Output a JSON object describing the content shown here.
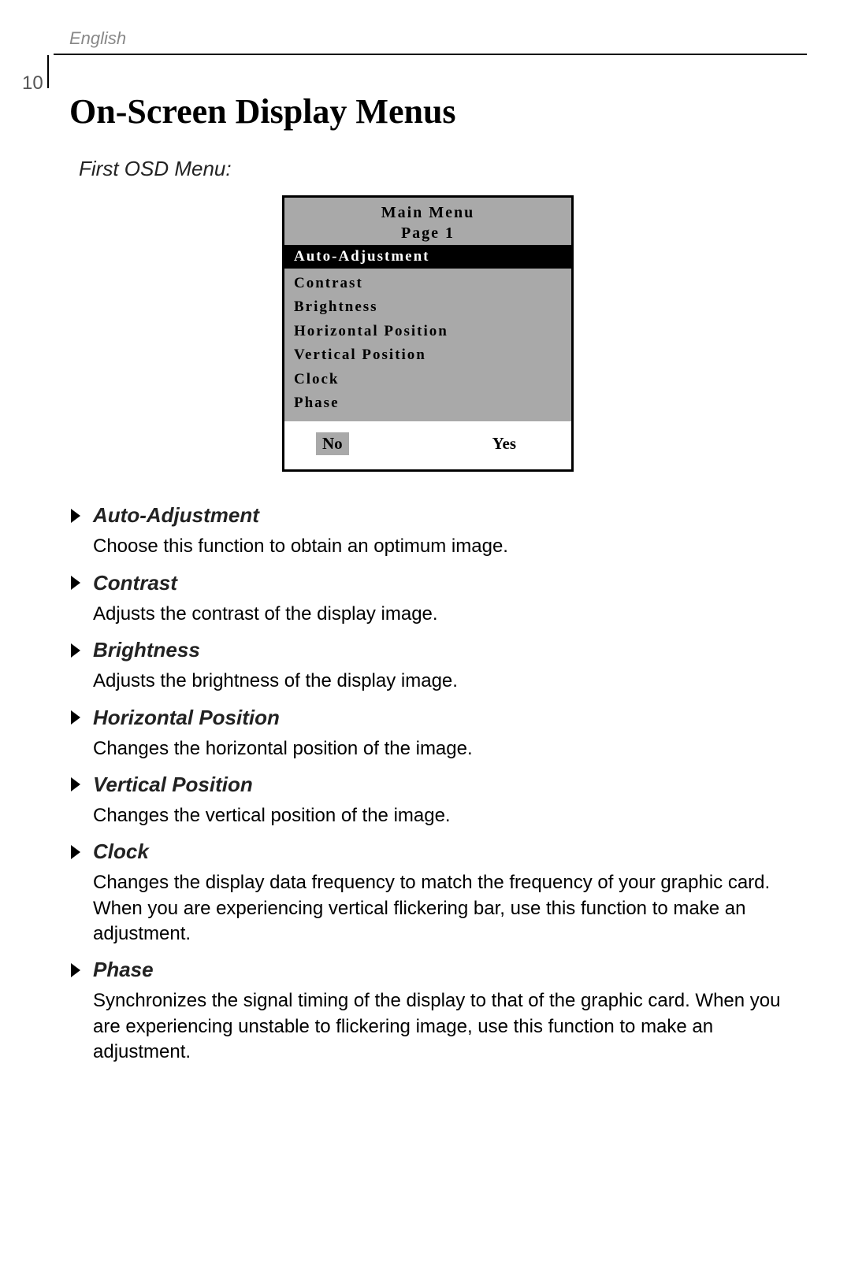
{
  "header": {
    "language": "English",
    "page_number": "10"
  },
  "title": "On-Screen Display Menus",
  "subtitle": "First OSD Menu:",
  "osd": {
    "header_line1": "Main Menu",
    "header_line2": "Page 1",
    "selected": "Auto-Adjustment",
    "items": [
      "Contrast",
      "Brightness",
      "Horizontal Position",
      "Vertical Position",
      "Clock",
      "Phase"
    ],
    "no_label": "No",
    "yes_label": "Yes"
  },
  "descriptions": [
    {
      "title": "Auto-Adjustment",
      "text": "Choose this function to obtain an optimum image."
    },
    {
      "title": "Contrast",
      "text": "Adjusts the contrast of the display image."
    },
    {
      "title": "Brightness",
      "text": "Adjusts the brightness of the display image."
    },
    {
      "title": "Horizontal Position",
      "text": "Changes the horizontal position of the image."
    },
    {
      "title": "Vertical Position",
      "text": "Changes the vertical position of  the image."
    },
    {
      "title": "Clock",
      "text": "Changes the display data frequency to match the frequency of your graphic card. When you are experiencing vertical flickering bar, use this function to make an adjustment."
    },
    {
      "title": "Phase",
      "text": "Synchronizes the signal timing of the display to that of the graphic card. When you are experiencing unstable to flickering image, use this function to make an adjustment."
    }
  ]
}
